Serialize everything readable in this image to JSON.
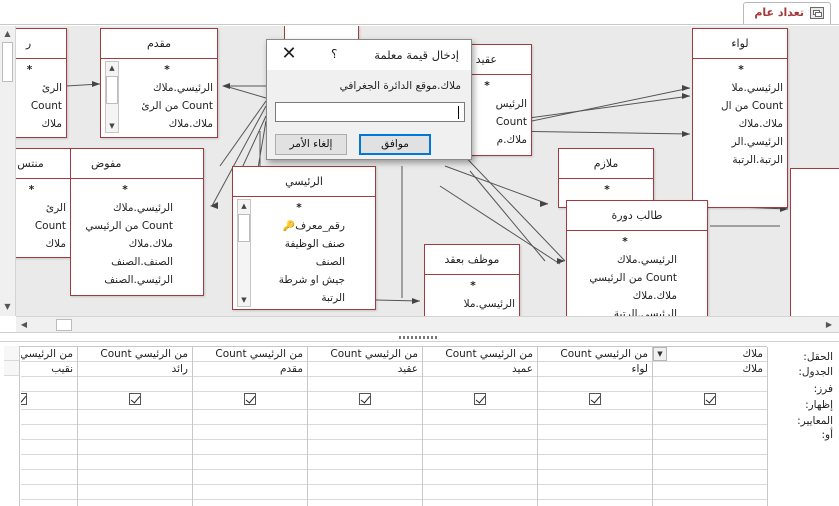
{
  "tab": {
    "title": "تعداد عام"
  },
  "tables": {
    "left_cut_top": {
      "title": "ر",
      "fields": [
        "*",
        "الرئ",
        "Count",
        "ملاك"
      ]
    },
    "muqaddam": {
      "title": "مقدم",
      "fields": [
        "*",
        "الرئيسي.ملاك",
        "Count من الرئ",
        "ملاك.ملاك"
      ]
    },
    "hidden_top": {
      "title": "",
      "fields": []
    },
    "aqid": {
      "title": "عقيد",
      "fields": [
        "*",
        "الرئيس",
        "Count",
        "ملاك.م"
      ]
    },
    "liwa": {
      "title": "لواء",
      "fields": [
        "*",
        "الرئيسي.ملا",
        "Count من ال",
        "ملاك.ملاك",
        "الرئيسي.الر",
        "الرتبة.الرتبة"
      ]
    },
    "left_cut_mid": {
      "title": "منتس",
      "fields": [
        "*",
        "الرئ",
        "Count",
        "ملاك"
      ]
    },
    "mufawwad": {
      "title": "مفوض",
      "fields": [
        "*",
        "الرئيسي.ملاك",
        "Count من الرئيسي",
        "ملاك.ملاك",
        "الصنف.الصنف",
        "الرئيسي.الصنف"
      ]
    },
    "raisi": {
      "title": "الرئيسي",
      "fields": [
        "*",
        "رقم_معرف",
        "صنف الوظيفة",
        "الصنف",
        "جيش او شرطة",
        "الرتبة"
      ]
    },
    "mulazim": {
      "title": "ملازم",
      "fields": [
        "*"
      ]
    },
    "talib": {
      "title": "طالب دورة",
      "fields": [
        "*",
        "الرئيسي.ملاك",
        "Count من الرئيسي",
        "ملاك.ملاك",
        "الرئيسي.الرتبة"
      ]
    },
    "muwazzaf": {
      "title": "موظف بعقد",
      "fields": [
        "*",
        "الرئيسي.ملا"
      ]
    },
    "right_cut": {
      "title": "",
      "fields": []
    }
  },
  "dialog": {
    "title": "إدخال قيمة معلمة",
    "help": "؟",
    "close": "✕",
    "prompt": "ملاك.موقع الدائرة الجغرافي",
    "input_value": "",
    "ok_label": "موافق",
    "cancel_label": "إلغاء الأمر"
  },
  "grid": {
    "row_labels": [
      "الحقل:",
      "الجدول:",
      "فرز:",
      "إظهار:",
      "المعايير:",
      "أو:"
    ],
    "columns": [
      {
        "field": "ملاك",
        "table": "ملاك",
        "show": true,
        "active": true
      },
      {
        "field": "من الرئيسي Count",
        "table": "لواء",
        "show": true
      },
      {
        "field": "من الرئيسي Count",
        "table": "عميد",
        "show": true
      },
      {
        "field": "من الرئيسي Count",
        "table": "عقيد",
        "show": true
      },
      {
        "field": "من الرئيسي Count",
        "table": "مقدم",
        "show": true
      },
      {
        "field": "من الرئيسي Count",
        "table": "رائد",
        "show": true
      },
      {
        "field": "من الرئيسي",
        "table": "نقيب",
        "show": true
      }
    ]
  },
  "icons": {
    "scroll_up": "▲",
    "scroll_down": "▼",
    "scroll_left": "◀",
    "scroll_right": "▶",
    "combo": "▼",
    "key": "🔑"
  }
}
